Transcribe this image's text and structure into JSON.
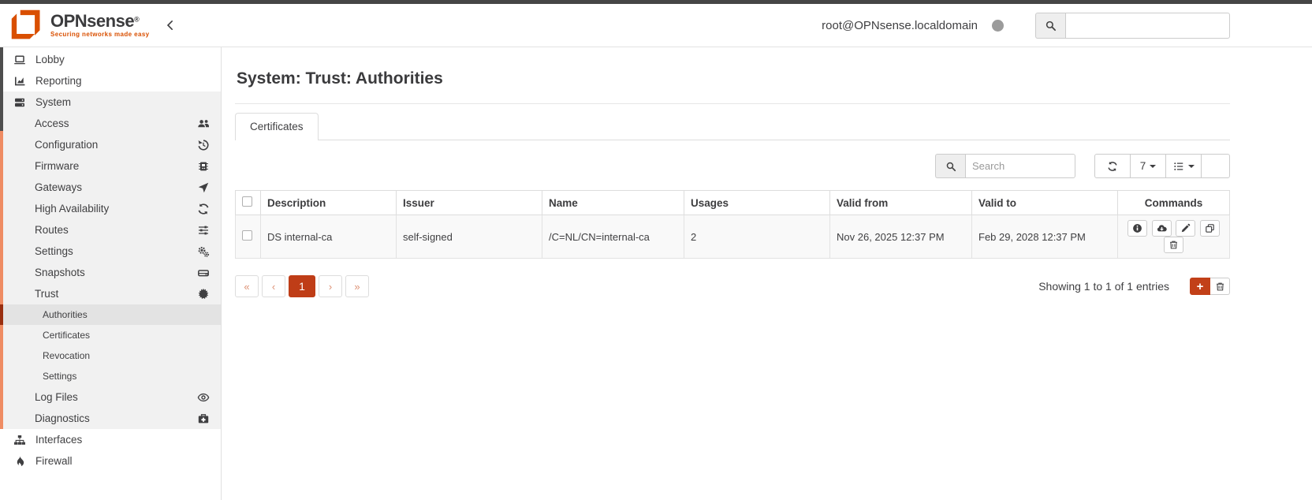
{
  "header": {
    "brand_name": "OPNsense",
    "brand_reg": "®",
    "tagline": "Securing networks made easy",
    "username": "root@OPNsense.localdomain",
    "search_placeholder": ""
  },
  "sidebar": {
    "items": [
      {
        "label": "Lobby",
        "icon": "laptop-icon"
      },
      {
        "label": "Reporting",
        "icon": "area-chart-icon"
      },
      {
        "label": "System",
        "icon": "server-icon"
      }
    ],
    "system_children": [
      {
        "label": "Access",
        "icon": "users-icon"
      },
      {
        "label": "Configuration",
        "icon": "history-icon"
      },
      {
        "label": "Firmware",
        "icon": "firmware-icon"
      },
      {
        "label": "Gateways",
        "icon": "location-arrow-icon"
      },
      {
        "label": "High Availability",
        "icon": "refresh-icon"
      },
      {
        "label": "Routes",
        "icon": "sliders-icon"
      },
      {
        "label": "Settings",
        "icon": "cogs-icon"
      },
      {
        "label": "Snapshots",
        "icon": "hdd-icon"
      },
      {
        "label": "Trust",
        "icon": "certificate-icon"
      }
    ],
    "trust_children": [
      {
        "label": "Authorities",
        "active": true
      },
      {
        "label": "Certificates"
      },
      {
        "label": "Revocation"
      },
      {
        "label": "Settings"
      }
    ],
    "system_children_after": [
      {
        "label": "Log Files",
        "icon": "eye-icon"
      },
      {
        "label": "Diagnostics",
        "icon": "medkit-icon"
      }
    ],
    "bottom_items": [
      {
        "label": "Interfaces",
        "icon": "sitemap-icon"
      },
      {
        "label": "Firewall",
        "icon": "fire-icon"
      }
    ]
  },
  "main": {
    "page_title": "System: Trust: Authorities",
    "tabs": [
      {
        "label": "Certificates",
        "active": true
      }
    ],
    "toolbar": {
      "search_placeholder": "Search",
      "page_size": "7"
    },
    "table": {
      "columns": [
        "Description",
        "Issuer",
        "Name",
        "Usages",
        "Valid from",
        "Valid to",
        "Commands"
      ],
      "rows": [
        {
          "description": "DS internal-ca",
          "issuer": "self-signed",
          "name": "/C=NL/CN=internal-ca",
          "usages": "2",
          "valid_from": "Nov 26, 2025 12:37 PM",
          "valid_to": "Feb 29, 2028 12:37 PM",
          "commands": [
            "info",
            "download",
            "edit",
            "clone",
            "delete"
          ]
        }
      ]
    },
    "pagination": {
      "first": "«",
      "prev": "‹",
      "page": "1",
      "next": "›",
      "last": "»",
      "summary": "Showing 1 to 1 of 1 entries",
      "add": "+"
    }
  },
  "colors": {
    "brand_orange": "#d94f00",
    "active_rust": "#bf3d17",
    "section_border": "#ef8c63",
    "active_item_border": "#992f10",
    "topbar": "#464646"
  }
}
